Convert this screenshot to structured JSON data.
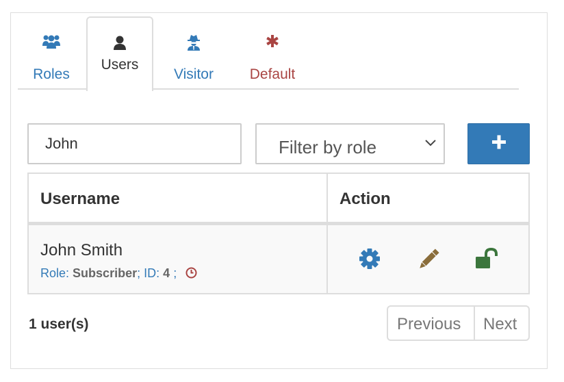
{
  "tabs": [
    {
      "label": "Roles",
      "icon": "users-icon",
      "color": "#337ab7"
    },
    {
      "label": "Users",
      "icon": "user-icon",
      "color": "#333333",
      "active": true
    },
    {
      "label": "Visitor",
      "icon": "user-secret-icon",
      "color": "#337ab7"
    },
    {
      "label": "Default",
      "icon": "asterisk-icon",
      "color": "#a94442"
    }
  ],
  "search": {
    "value": "John"
  },
  "role_filter": {
    "selected": "Filter by role"
  },
  "add_button": {
    "icon": "plus-icon",
    "color": "#337ab7"
  },
  "table": {
    "headers": {
      "username": "Username",
      "action": "Action"
    },
    "rows": [
      {
        "name": "John Smith",
        "role_label": "Role:",
        "role_value": "Subscriber",
        "sep": ";",
        "id_label": "ID:",
        "id_value": "4",
        "id_sep": ";",
        "status_icon": "clock-icon",
        "actions": [
          {
            "icon": "gear-icon",
            "color": "#337ab7"
          },
          {
            "icon": "pencil-icon",
            "color": "#8a6d3b"
          },
          {
            "icon": "unlock-icon",
            "color": "#3c763d"
          }
        ]
      }
    ]
  },
  "footer": {
    "count": "1 user(s)",
    "previous": "Previous",
    "next": "Next"
  }
}
